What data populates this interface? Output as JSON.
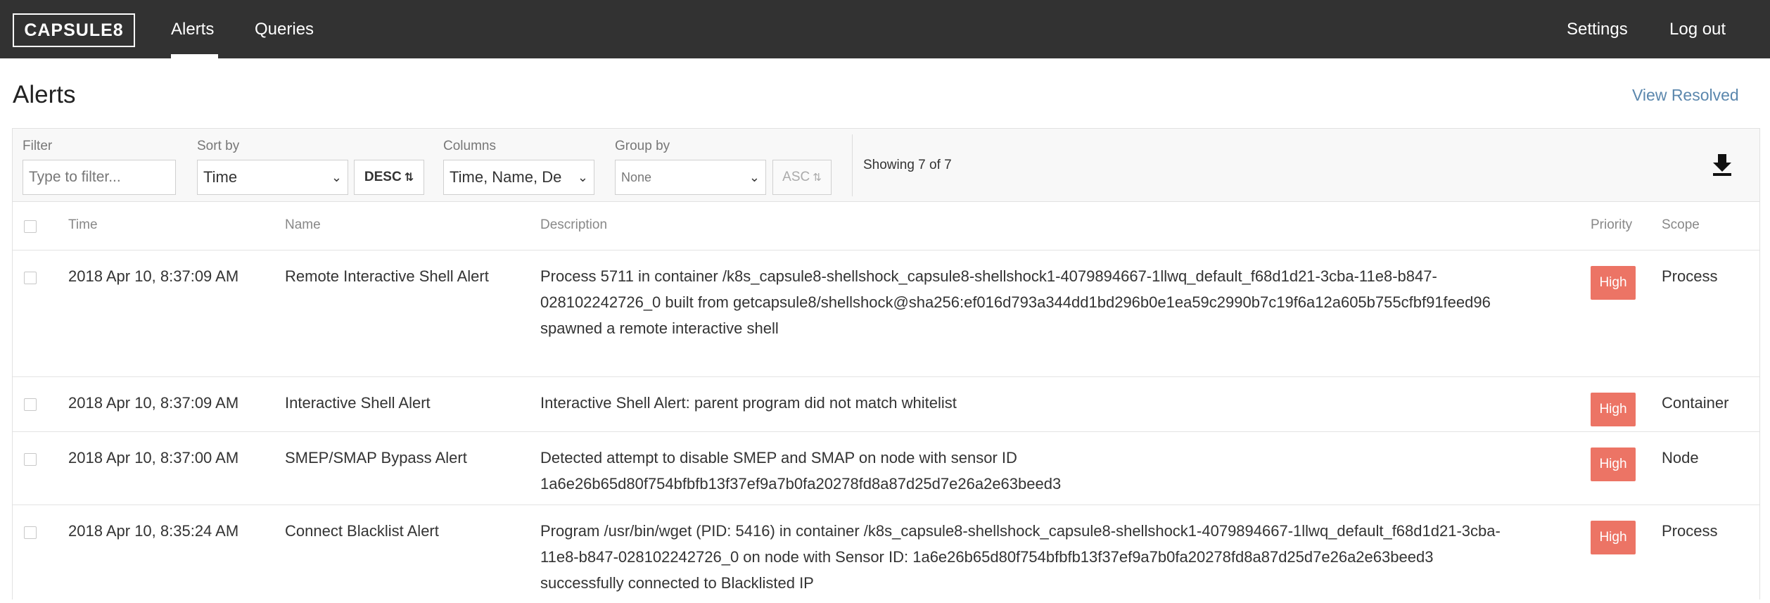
{
  "nav": {
    "logo": "CAPSULE8",
    "alerts": "Alerts",
    "queries": "Queries",
    "settings": "Settings",
    "logout": "Log out"
  },
  "page": {
    "title": "Alerts",
    "view_resolved": "View Resolved"
  },
  "toolbar": {
    "filter_label": "Filter",
    "filter_placeholder": "Type to filter...",
    "sort_label": "Sort by",
    "sort_value": "Time",
    "sort_order": "DESC",
    "columns_label": "Columns",
    "columns_value": "Time, Name, De",
    "group_label": "Group by",
    "group_value": "None",
    "group_order": "ASC",
    "showing": "Showing 7 of 7",
    "download_icon": "download-icon"
  },
  "table": {
    "headers": [
      "Time",
      "Name",
      "Description",
      "Priority",
      "Scope"
    ],
    "rows": [
      {
        "time": "2018 Apr 10, 8:37:09 AM",
        "name": "Remote Interactive Shell Alert",
        "description": "Process 5711 in container /k8s_capsule8-shellshock_capsule8-shellshock1-4079894667-1llwq_default_f68d1d21-3cba-11e8-b847-028102242726_0 built from getcapsule8/shellshock@sha256:ef016d793a344dd1bd296b0e1ea59c2990b7c19f6a12a605b755cfbf91feed96 spawned a remote interactive shell",
        "priority": "High",
        "scope": "Process"
      },
      {
        "time": "2018 Apr 10, 8:37:09 AM",
        "name": "Interactive Shell Alert",
        "description": "Interactive Shell Alert: parent program did not match whitelist",
        "priority": "High",
        "scope": "Container"
      },
      {
        "time": "2018 Apr 10, 8:37:00 AM",
        "name": "SMEP/SMAP Bypass Alert",
        "description": "Detected attempt to disable SMEP and SMAP on node with sensor ID 1a6e26b65d80f754bfbfb13f37ef9a7b0fa20278fd8a87d25d7e26a2e63beed3",
        "priority": "High",
        "scope": "Node"
      },
      {
        "time": "2018 Apr 10, 8:35:24 AM",
        "name": "Connect Blacklist Alert",
        "description": "Program /usr/bin/wget (PID: 5416) in container /k8s_capsule8-shellshock_capsule8-shellshock1-4079894667-1llwq_default_f68d1d21-3cba-11e8-b847-028102242726_0 on node with Sensor ID: 1a6e26b65d80f754bfbfb13f37ef9a7b0fa20278fd8a87d25d7e26a2e63beed3 successfully connected to Blacklisted IP",
        "priority": "High",
        "scope": "Process"
      }
    ]
  },
  "colors": {
    "nav_bg": "#323232",
    "priority_high": "#ec7465",
    "link": "#5b87ad"
  }
}
